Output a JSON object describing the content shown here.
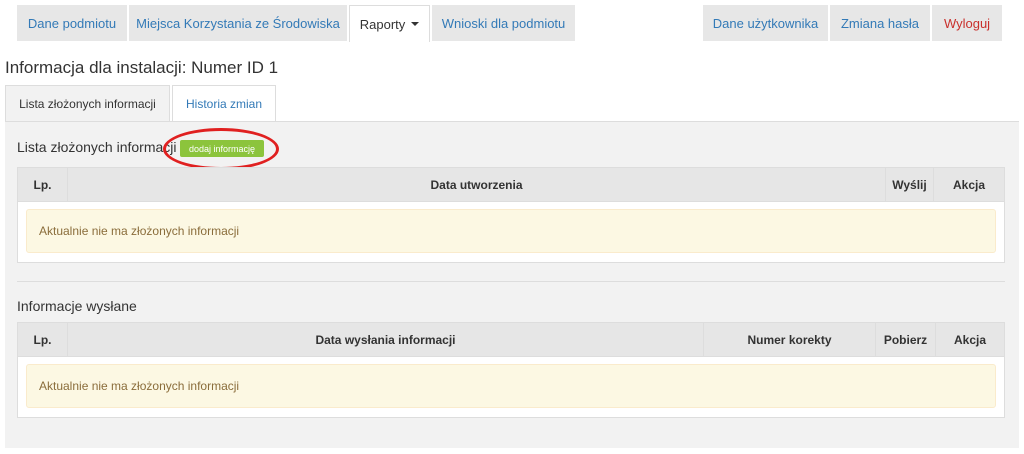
{
  "nav": {
    "left_items": [
      "Dane podmiotu",
      "Miejsca Korzystania ze Środowiska",
      "Raporty",
      "Wnioski dla podmiotu"
    ],
    "right_items": [
      "Dane użytkownika",
      "Zmiana hasła",
      "Wyloguj"
    ],
    "active": "Raporty"
  },
  "page_title": "Informacja dla instalacji: Numer ID 1",
  "subtabs": [
    "Lista złożonych informacji",
    "Historia zmian"
  ],
  "section1": {
    "title": "Lista złożonych informacji",
    "add_button": "dodaj informację",
    "columns": [
      "Lp.",
      "Data utworzenia",
      "Wyślij",
      "Akcja"
    ],
    "empty_message": "Aktualnie nie ma złożonych informacji"
  },
  "section2": {
    "title": "Informacje wysłane",
    "columns": [
      "Lp.",
      "Data wysłania informacji",
      "Numer korekty",
      "Pobierz",
      "Akcja"
    ],
    "empty_message": "Aktualnie nie ma złożonych informacji"
  },
  "colors": {
    "link": "#337ab7",
    "logout": "#c9302c",
    "add_button": "#8cc43c",
    "highlight": "#e02020",
    "empty_bg": "#fcf8e3"
  }
}
